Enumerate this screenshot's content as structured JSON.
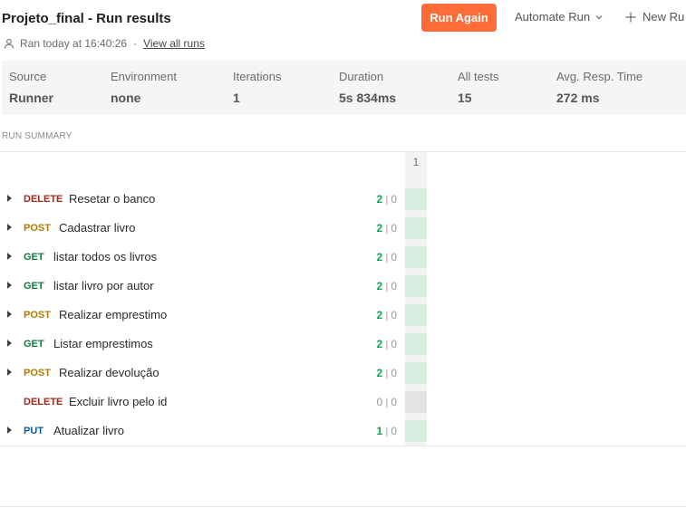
{
  "header": {
    "title": "Projeto_final - Run results",
    "run_again": "Run Again",
    "automate_run": "Automate Run",
    "new_run": "New Ru",
    "ran_at": "Ran today at 16:40:26",
    "separator": "·",
    "view_all_runs": "View all runs"
  },
  "stats": [
    {
      "label": "Source",
      "value": "Runner"
    },
    {
      "label": "Environment",
      "value": "none"
    },
    {
      "label": "Iterations",
      "value": "1"
    },
    {
      "label": "Duration",
      "value": "5s 834ms"
    },
    {
      "label": "All tests",
      "value": "15"
    },
    {
      "label": "Avg. Resp. Time",
      "value": "272 ms"
    }
  ],
  "summary": {
    "title": "RUN SUMMARY",
    "iteration_header": "1",
    "count_separator": "|",
    "rows": [
      {
        "method": "DELETE",
        "name": "Resetar o banco",
        "passed": "2",
        "failed": "0",
        "expandable": true,
        "status": "ok"
      },
      {
        "method": "POST",
        "name": "Cadastrar livro",
        "passed": "2",
        "failed": "0",
        "expandable": true,
        "status": "ok"
      },
      {
        "method": "GET",
        "name": "listar todos os livros",
        "passed": "2",
        "failed": "0",
        "expandable": true,
        "status": "ok"
      },
      {
        "method": "GET",
        "name": "listar livro por autor",
        "passed": "2",
        "failed": "0",
        "expandable": true,
        "status": "ok"
      },
      {
        "method": "POST",
        "name": "Realizar emprestimo",
        "passed": "2",
        "failed": "0",
        "expandable": true,
        "status": "ok"
      },
      {
        "method": "GET",
        "name": "Listar emprestimos",
        "passed": "2",
        "failed": "0",
        "expandable": true,
        "status": "ok"
      },
      {
        "method": "POST",
        "name": "Realizar devolução",
        "passed": "2",
        "failed": "0",
        "expandable": true,
        "status": "ok"
      },
      {
        "method": "DELETE",
        "name": "Excluir livro pelo id",
        "passed": "0",
        "failed": "0",
        "expandable": false,
        "status": "none"
      },
      {
        "method": "PUT",
        "name": "Atualizar livro",
        "passed": "1",
        "failed": "0",
        "expandable": true,
        "status": "ok"
      }
    ]
  },
  "colors": {
    "accent": "#ff6c37",
    "pass": "#0fa34d",
    "delete": "#a0281b",
    "post": "#ad7a03",
    "get": "#0a7a3e",
    "put": "#0c5ba5"
  }
}
